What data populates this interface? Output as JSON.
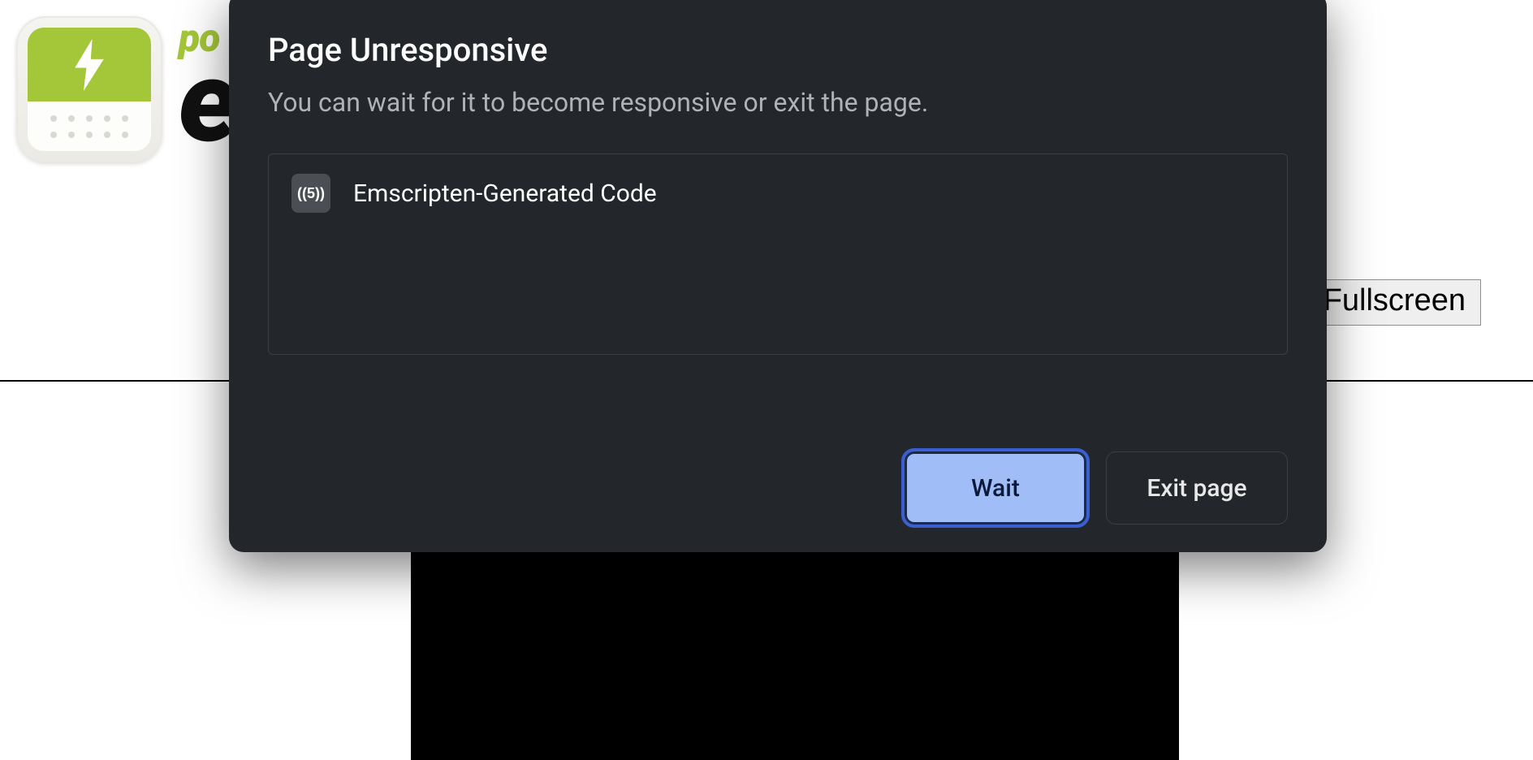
{
  "page": {
    "wordmark_top": "po",
    "wordmark_bottom": "en",
    "fullscreen_label": "Fullscreen"
  },
  "dialog": {
    "title": "Page Unresponsive",
    "subtitle": "You can wait for it to become responsive or exit the page.",
    "items": [
      {
        "favicon_text": "((5))",
        "label": "Emscripten-Generated Code"
      }
    ],
    "wait_label": "Wait",
    "exit_label": "Exit page"
  }
}
